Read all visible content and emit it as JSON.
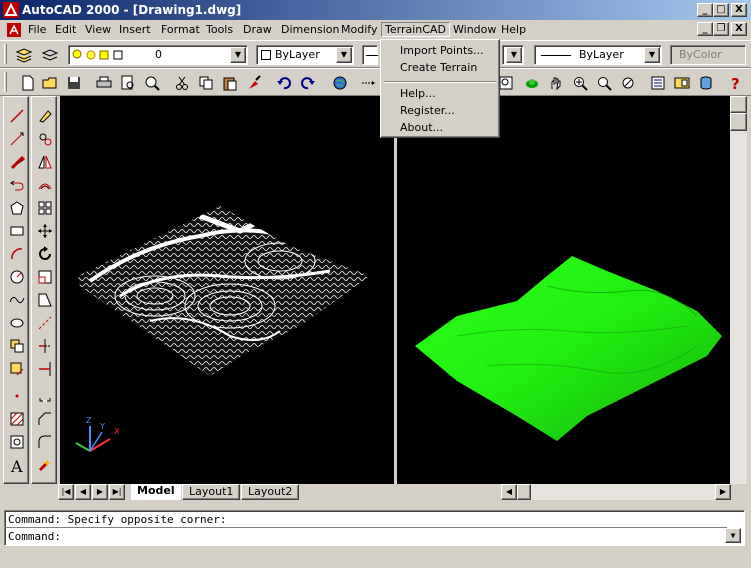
{
  "titlebar": {
    "title": "AutoCAD 2000 - [Drawing1.dwg]",
    "min": "_",
    "max": "□",
    "close": "X"
  },
  "menubar": {
    "items": [
      "File",
      "Edit",
      "View",
      "Insert",
      "Format",
      "Tools",
      "Draw",
      "Dimension",
      "Modify",
      "TerrainCAD",
      "Window",
      "Help"
    ],
    "doc_min": "_",
    "doc_restore": "❐",
    "doc_close": "X"
  },
  "dropdown": {
    "items": [
      "Import Points...",
      "Create Terrain",
      "Help...",
      "Register...",
      "About..."
    ]
  },
  "layer_toolbar": {
    "layer_value": "0",
    "color_value": "ByLayer",
    "linetype_value": "ByLayer",
    "lineweight_value": "ByLayer",
    "plotstyle_value": "ByColor"
  },
  "tabs": {
    "model": "Model",
    "layout1": "Layout1",
    "layout2": "Layout2"
  },
  "command": {
    "history": "Command: Specify opposite corner:",
    "prompt": "Command:"
  },
  "ucs": {
    "x": "X",
    "y": "Y",
    "z": "Z"
  },
  "colors": {
    "terrain_green": "#22ee11",
    "title_start": "#0a246a",
    "title_end": "#a6caf0"
  }
}
